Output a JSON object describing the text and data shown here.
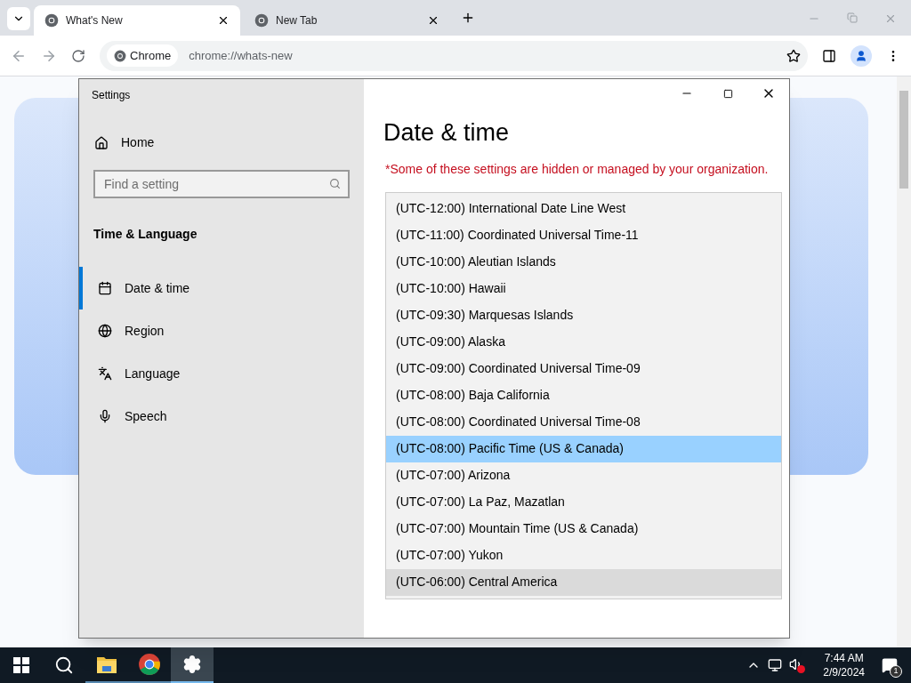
{
  "browser": {
    "tabs": [
      {
        "title": "What's New",
        "selected": true
      },
      {
        "title": "New Tab",
        "selected": false
      }
    ],
    "omnibox": {
      "chip": "Chrome",
      "url": "chrome://whats-new"
    }
  },
  "settings": {
    "title": "Settings",
    "home": "Home",
    "search": {
      "placeholder": "Find a setting"
    },
    "section": "Time & Language",
    "nav": [
      {
        "label": "Date & time",
        "selected": true
      },
      {
        "label": "Region",
        "selected": false
      },
      {
        "label": "Language",
        "selected": false
      },
      {
        "label": "Speech",
        "selected": false
      }
    ],
    "page_title": "Date & time",
    "notice": "*Some of these settings are hidden or managed by your organization.",
    "timezones": [
      {
        "label": "(UTC-12:00) International Date Line West",
        "selected": false,
        "hovered": false
      },
      {
        "label": "(UTC-11:00) Coordinated Universal Time-11",
        "selected": false,
        "hovered": false
      },
      {
        "label": "(UTC-10:00) Aleutian Islands",
        "selected": false,
        "hovered": false
      },
      {
        "label": "(UTC-10:00) Hawaii",
        "selected": false,
        "hovered": false
      },
      {
        "label": "(UTC-09:30) Marquesas Islands",
        "selected": false,
        "hovered": false
      },
      {
        "label": "(UTC-09:00) Alaska",
        "selected": false,
        "hovered": false
      },
      {
        "label": "(UTC-09:00) Coordinated Universal Time-09",
        "selected": false,
        "hovered": false
      },
      {
        "label": "(UTC-08:00) Baja California",
        "selected": false,
        "hovered": false
      },
      {
        "label": "(UTC-08:00) Coordinated Universal Time-08",
        "selected": false,
        "hovered": false
      },
      {
        "label": "(UTC-08:00) Pacific Time (US & Canada)",
        "selected": true,
        "hovered": false
      },
      {
        "label": "(UTC-07:00) Arizona",
        "selected": false,
        "hovered": false
      },
      {
        "label": "(UTC-07:00) La Paz, Mazatlan",
        "selected": false,
        "hovered": false
      },
      {
        "label": "(UTC-07:00) Mountain Time (US & Canada)",
        "selected": false,
        "hovered": false
      },
      {
        "label": "(UTC-07:00) Yukon",
        "selected": false,
        "hovered": false
      },
      {
        "label": "(UTC-06:00) Central America",
        "selected": false,
        "hovered": true
      }
    ]
  },
  "taskbar": {
    "apps": [
      {
        "kind": "explorer",
        "selected": false
      },
      {
        "kind": "chrome",
        "selected": false
      },
      {
        "kind": "settings",
        "selected": true
      }
    ],
    "time": "7:44 AM",
    "date": "2/9/2024",
    "notifications": "1"
  }
}
